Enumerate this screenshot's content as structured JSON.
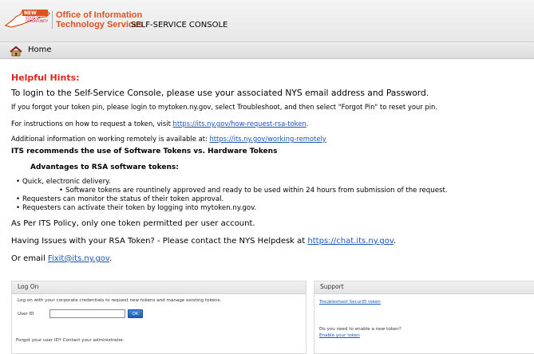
{
  "header": {
    "logo_line1": "NEW YORK",
    "logo_line2": "STATE OF OPPORTUNITY",
    "org_line1": "Office of Information",
    "org_line2": "Technology Services",
    "console_title": "SELF-SERVICE CONSOLE"
  },
  "nav": {
    "home_label": "Home"
  },
  "hints": {
    "title": "Helpful Hints:",
    "login_line": "To login to the Self-Service Console, please use your associated NYS email address and Password.",
    "forgot_pin_line": "If you forgot your token pin, please login to mytoken.ny.gov, select Troubleshoot, and then select \"Forgot Pin\" to reset your pin.",
    "instructions_prefix": "For instructions on how to request a token, visit ",
    "instructions_link": "https://its.ny.gov/how-request-rsa-token",
    "instructions_suffix": ".",
    "remote_prefix": "Additional information on working remotely is available at: ",
    "remote_link": "https://its.ny.gov/working-remotely",
    "recommend_line": "ITS recommends the use of Software Tokens vs. Hardware Tokens",
    "advantages_title": "Advantages to RSA software tokens:",
    "bullets": [
      "Quick, electronic delivery.",
      "Software tokens are rountinely approved and ready to be used within 24 hours from submission of the request.",
      "Requesters can monitor the status of their token approval.",
      "Requesters can activate their token by logging into mytoken.ny.gov."
    ],
    "policy_line": "As Per ITS Policy, only one token permitted per user account.",
    "issues_prefix": "Having Issues with your RSA Token? - Please contact the NYS Helpdesk at ",
    "issues_link": "https://chat.its.ny.gov",
    "issues_suffix": ".",
    "email_prefix": "Or email ",
    "email_link": "Fixit@its.ny.gov",
    "email_suffix": "."
  },
  "logon": {
    "title": "Log On",
    "description": "Log on with your corporate credentials to request new tokens and manage existing tokens.",
    "userid_label": "User ID",
    "userid_value": "",
    "ok_label": "OK",
    "forgot_text": "Forgot your user ID? Contact your administrator."
  },
  "support": {
    "title": "Support",
    "troubleshoot_link": "Troubleshoot SecurID token",
    "enable_question": "Do you need to enable a new token?",
    "enable_link": "Enable your token"
  },
  "colors": {
    "accent_red": "#e4251b",
    "link_blue": "#1a55b7",
    "org_orange": "#d9541e",
    "ok_button": "#1d5fb0"
  }
}
